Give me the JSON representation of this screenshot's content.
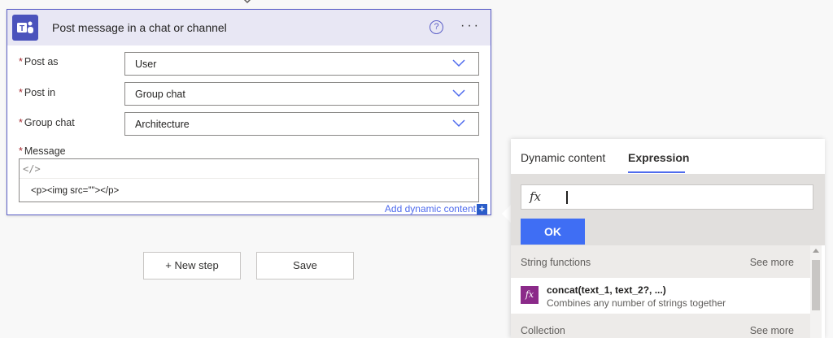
{
  "card": {
    "title": "Post message in a chat or channel",
    "help": "?",
    "more": "···",
    "fields": [
      {
        "label": "Post as",
        "value": "User"
      },
      {
        "label": "Post in",
        "value": "Group chat"
      },
      {
        "label": "Group chat",
        "value": "Architecture"
      }
    ],
    "required_marker": "*",
    "message_label": "Message",
    "message_code_icon": "</>",
    "message_value": "<p><img src=\"\"></p>",
    "add_dynamic_label": "Add dynamic content",
    "add_dynamic_icon": "+"
  },
  "actions": {
    "new_step": "+ New step",
    "save": "Save"
  },
  "panel": {
    "tabs": [
      {
        "label": "Dynamic content",
        "active": false
      },
      {
        "label": "Expression",
        "active": true
      }
    ],
    "fx_symbol": "fx",
    "ok_label": "OK",
    "sections": [
      {
        "title": "String functions",
        "see_more": "See more"
      },
      {
        "title": "Collection",
        "see_more": "See more"
      }
    ],
    "functions": [
      {
        "name": "concat(text_1, text_2?, ...)",
        "description": "Combines any number of strings together",
        "icon": "fx"
      }
    ]
  },
  "colors": {
    "accent": "#4f6bed",
    "teams_purple": "#4b53bc",
    "required": "#a4262c",
    "ok_button": "#3f6ef4",
    "function_icon": "#8b2a89"
  }
}
